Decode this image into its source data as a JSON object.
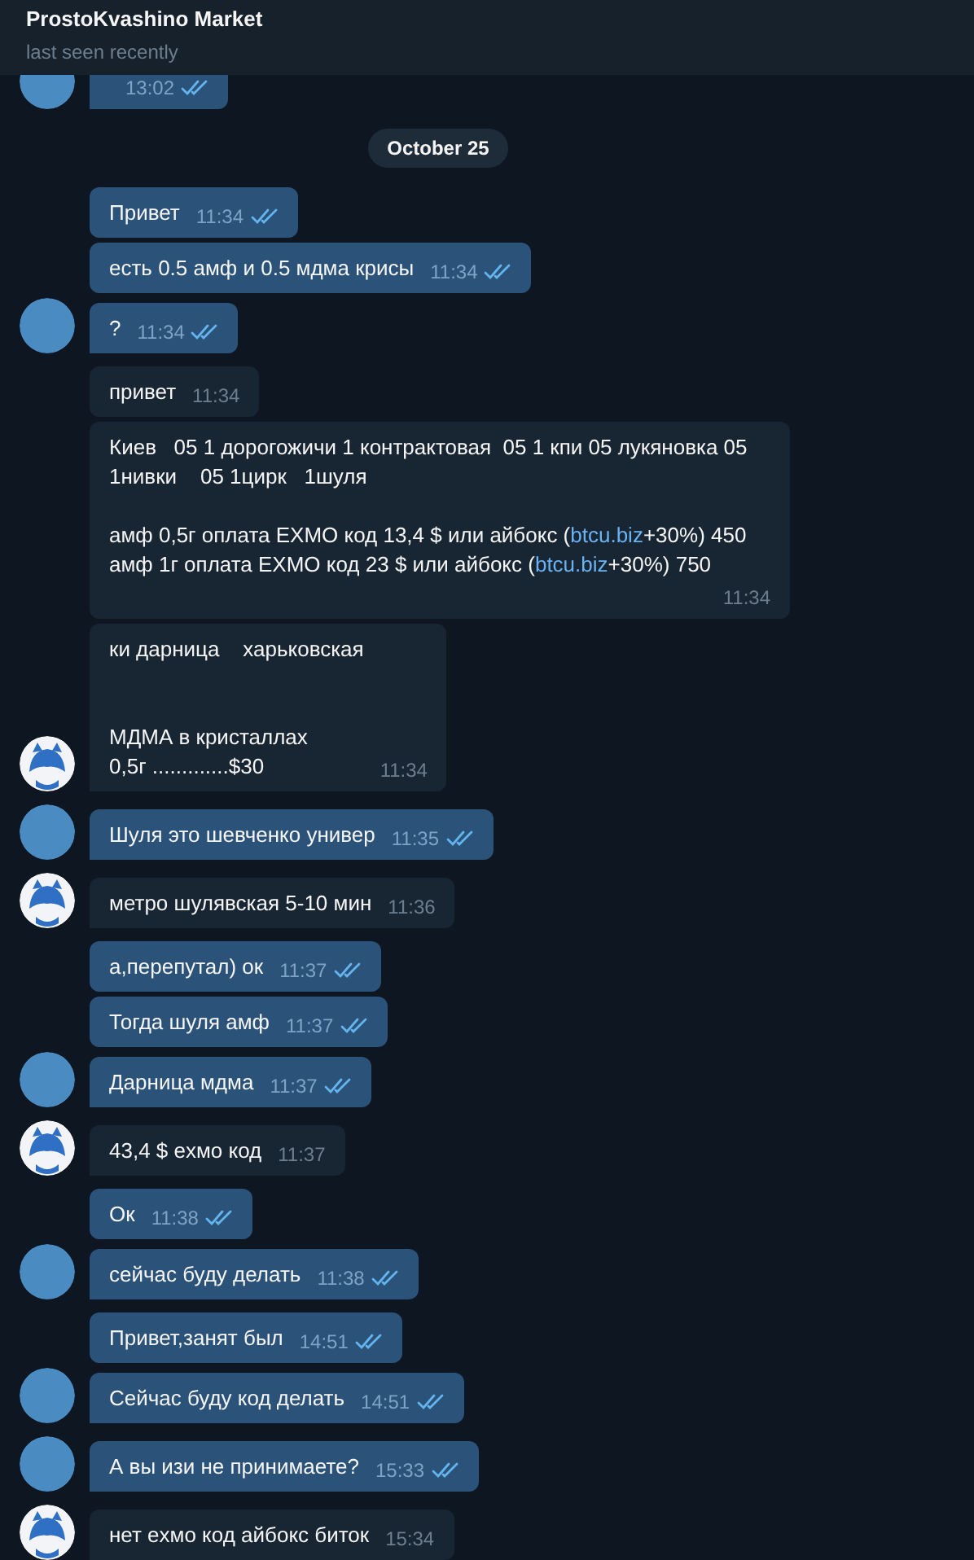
{
  "header": {
    "title": "ProstoKvashino Market",
    "status": "last seen recently"
  },
  "messages": [
    {
      "kind": "out",
      "avatar": true,
      "time": "13:02",
      "read": true
    },
    {
      "kind": "date",
      "text": "October 25"
    },
    {
      "kind": "out",
      "avatar": false,
      "parts": [
        {
          "text": "Привет"
        }
      ],
      "time": "11:34",
      "read": true
    },
    {
      "kind": "out",
      "avatar": false,
      "parts": [
        {
          "text": "есть 0.5 амф и 0.5 мдма крисы"
        }
      ],
      "time": "11:34",
      "read": true
    },
    {
      "kind": "out",
      "avatar": true,
      "parts": [
        {
          "text": "?"
        }
      ],
      "time": "11:34",
      "read": true
    },
    {
      "kind": "in",
      "avatar": false,
      "parts": [
        {
          "text": "привет"
        }
      ],
      "time": "11:34"
    },
    {
      "kind": "in",
      "avatar": false,
      "block": true,
      "parts": [
        {
          "text": "Киев   05 1 дорогожичи 1 контрактовая  05 1 кпи 05 лукяновка 05 1нивки    05 1цирк   1шуля\n\nамф 0,5г оплата EXMO код 13,4 $ или айбокс ("
        },
        {
          "text": "btcu.biz",
          "link": true
        },
        {
          "text": "+30%) 450\nамф 1г оплата EXMO код 23 $ или айбокс ("
        },
        {
          "text": "btcu.biz",
          "link": true
        },
        {
          "text": "+30%) 750"
        }
      ],
      "time": "11:34"
    },
    {
      "kind": "in",
      "avatar": true,
      "parts": [
        {
          "text": "ки дарница    харьковская\n\n\nМДМА в кристаллах\n0,5г .............$30"
        }
      ],
      "time": "11:34"
    },
    {
      "kind": "out",
      "avatar": true,
      "parts": [
        {
          "text": "Шуля это шевченко универ"
        }
      ],
      "time": "11:35",
      "read": true
    },
    {
      "kind": "in",
      "avatar": true,
      "parts": [
        {
          "text": "метро шулявская 5-10 мин"
        }
      ],
      "time": "11:36"
    },
    {
      "kind": "out",
      "avatar": false,
      "parts": [
        {
          "text": "а,перепутал) ок"
        }
      ],
      "time": "11:37",
      "read": true
    },
    {
      "kind": "out",
      "avatar": false,
      "parts": [
        {
          "text": "Тогда шуля амф"
        }
      ],
      "time": "11:37",
      "read": true
    },
    {
      "kind": "out",
      "avatar": true,
      "parts": [
        {
          "text": "Дарница мдма"
        }
      ],
      "time": "11:37",
      "read": true
    },
    {
      "kind": "in",
      "avatar": true,
      "parts": [
        {
          "text": "43,4 $ exмо код"
        }
      ],
      "time": "11:37"
    },
    {
      "kind": "out",
      "avatar": false,
      "parts": [
        {
          "text": "Ок"
        }
      ],
      "time": "11:38",
      "read": true
    },
    {
      "kind": "out",
      "avatar": true,
      "parts": [
        {
          "text": "сейчас буду делать"
        }
      ],
      "time": "11:38",
      "read": true
    },
    {
      "kind": "out",
      "avatar": false,
      "parts": [
        {
          "text": "Привет,занят был"
        }
      ],
      "time": "14:51",
      "read": true
    },
    {
      "kind": "out",
      "avatar": true,
      "parts": [
        {
          "text": "Сейчас буду код делать"
        }
      ],
      "time": "14:51",
      "read": true
    },
    {
      "kind": "out",
      "avatar": true,
      "parts": [
        {
          "text": "А вы изи не принимаете?"
        }
      ],
      "time": "15:33",
      "read": true
    },
    {
      "kind": "in",
      "avatar": true,
      "parts": [
        {
          "text": "нет exмо код айбокс биток"
        }
      ],
      "time": "15:34"
    }
  ]
}
